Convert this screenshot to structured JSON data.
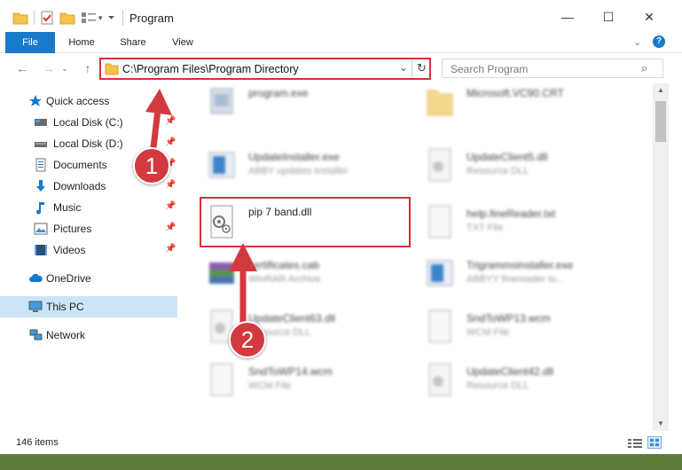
{
  "window": {
    "title": "Program",
    "controls": {
      "minimize": "—",
      "maximize": "☐",
      "close": "✕"
    }
  },
  "ribbon": {
    "tabs": [
      "File",
      "Home",
      "Share",
      "View"
    ]
  },
  "address": {
    "path": "C:\\Program Files\\Program Directory"
  },
  "search": {
    "placeholder": "Search Program"
  },
  "sidebar": {
    "items": [
      {
        "label": "Quick access",
        "icon": "star-icon",
        "pinned": false
      },
      {
        "label": "Local Disk (C:)",
        "icon": "drive-icon",
        "pinned": true
      },
      {
        "label": "Local Disk (D:)",
        "icon": "drive-icon",
        "pinned": true
      },
      {
        "label": "Documents",
        "icon": "documents-icon",
        "pinned": true
      },
      {
        "label": "Downloads",
        "icon": "download-icon",
        "pinned": true
      },
      {
        "label": "Music",
        "icon": "music-icon",
        "pinned": true
      },
      {
        "label": "Pictures",
        "icon": "pictures-icon",
        "pinned": true
      },
      {
        "label": "Videos",
        "icon": "videos-icon",
        "pinned": true
      },
      {
        "label": "OneDrive",
        "icon": "cloud-icon",
        "pinned": false
      },
      {
        "label": "This PC",
        "icon": "computer-icon",
        "pinned": false,
        "selected": true
      },
      {
        "label": "Network",
        "icon": "network-icon",
        "pinned": false
      }
    ]
  },
  "files": [
    {
      "name": "program.exe",
      "type": ""
    },
    {
      "name": "Microsoft.VC90.CRT",
      "type": ""
    },
    {
      "name": "UpdateInstaller.exe",
      "type": "ABBY updates installer"
    },
    {
      "name": "UpdateClient5.dll",
      "type": "Resource DLL"
    },
    {
      "name": "pip 7 band.dll",
      "type": ""
    },
    {
      "name": "help.fineReader.txt",
      "type": "TXT File"
    },
    {
      "name": "certificates.cab",
      "type": "WinRAR Archive"
    },
    {
      "name": "Trigrammsinstaller.exe",
      "type": "ABBYY finereader to..."
    },
    {
      "name": "UpdateClient63.dll",
      "type": "Resource DLL"
    },
    {
      "name": "SndToWP13.wcm",
      "type": "WCM File"
    },
    {
      "name": "SndToWP14.wcm",
      "type": "WCM File"
    },
    {
      "name": "UpdateClient42.dll",
      "type": "Resource DLL"
    }
  ],
  "status": {
    "count": "146 items"
  },
  "annotations": {
    "step1": "1",
    "step2": "2"
  },
  "colors": {
    "accent": "#1979ca",
    "highlight": "#d92f3a",
    "selected": "#cce4f7"
  }
}
